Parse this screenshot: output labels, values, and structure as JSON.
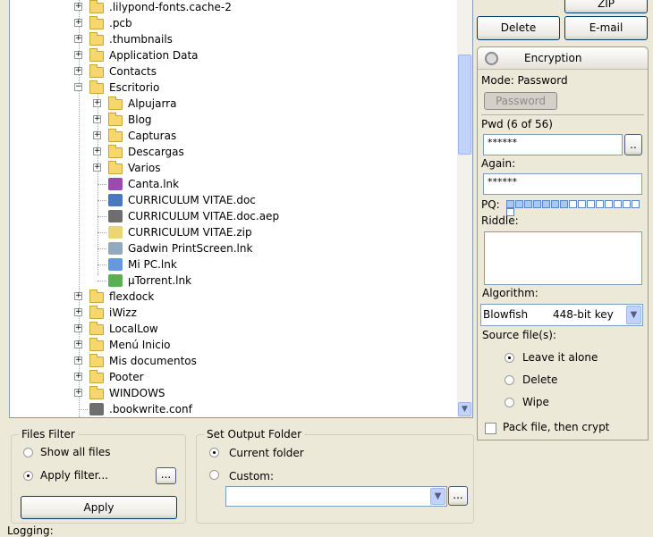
{
  "tree": {
    "items": [
      {
        "label": ".lilypond-fonts.cache-2",
        "level": 1,
        "type": "folder",
        "expander": "+"
      },
      {
        "label": ".pcb",
        "level": 1,
        "type": "folder",
        "expander": "+"
      },
      {
        "label": ".thumbnails",
        "level": 1,
        "type": "folder",
        "expander": "+"
      },
      {
        "label": "Application Data",
        "level": 1,
        "type": "folder",
        "expander": "+"
      },
      {
        "label": "Contacts",
        "level": 1,
        "type": "folder",
        "expander": "+"
      },
      {
        "label": "Escritorio",
        "level": 1,
        "type": "folder",
        "expander": "-"
      },
      {
        "label": "Alpujarra",
        "level": 2,
        "type": "folder",
        "expander": "+"
      },
      {
        "label": "Blog",
        "level": 2,
        "type": "folder",
        "expander": "+"
      },
      {
        "label": "Capturas",
        "level": 2,
        "type": "folder",
        "expander": "+"
      },
      {
        "label": "Descargas",
        "level": 2,
        "type": "folder",
        "expander": "+"
      },
      {
        "label": "Varios",
        "level": 2,
        "type": "folder",
        "expander": "+"
      },
      {
        "label": "Canta.lnk",
        "level": 2,
        "type": "shortcut-icon",
        "color": "#8a2b9e"
      },
      {
        "label": "CURRICULUM VITAE.doc",
        "level": 2,
        "type": "word-doc-icon",
        "color": "#2b5fb4"
      },
      {
        "label": "CURRICULUM VITAE.doc.aep",
        "level": 2,
        "type": "key-icon",
        "color": "#555555"
      },
      {
        "label": "CURRICULUM VITAE.zip",
        "level": 2,
        "type": "zip-icon",
        "color": "#e8cf5a"
      },
      {
        "label": "Gadwin PrintScreen.lnk",
        "level": 2,
        "type": "printscreen-icon",
        "color": "#7f9bb5"
      },
      {
        "label": "Mi PC.lnk",
        "level": 2,
        "type": "computer-icon",
        "color": "#4a86d6"
      },
      {
        "label": "µTorrent.lnk",
        "level": 2,
        "type": "utorrent-icon",
        "color": "#3aa335"
      },
      {
        "label": "flexdock",
        "level": 1,
        "type": "folder",
        "expander": "+"
      },
      {
        "label": "iWizz",
        "level": 1,
        "type": "folder",
        "expander": "+"
      },
      {
        "label": "LocalLow",
        "level": 1,
        "type": "folder",
        "expander": "+"
      },
      {
        "label": "Menú Inicio",
        "level": 1,
        "type": "folder",
        "expander": "+"
      },
      {
        "label": "Mis documentos",
        "level": 1,
        "type": "folder",
        "expander": "+"
      },
      {
        "label": "Pooter",
        "level": 1,
        "type": "folder",
        "expander": "+"
      },
      {
        "label": "WINDOWS",
        "level": 1,
        "type": "folder",
        "expander": "+"
      },
      {
        "label": ".bookwrite.conf",
        "level": 1,
        "type": "config-file-icon",
        "color": "#555555"
      }
    ]
  },
  "actions": {
    "zip": "ZIP",
    "delete": "Delete",
    "email": "E-mail"
  },
  "encryption": {
    "title": "Encryption",
    "mode": "Mode: Password",
    "mode_button": "Password",
    "pwd_label": "Pwd (6 of 56)",
    "pwd_value": "******",
    "browse": "..",
    "again_label": "Again:",
    "again_value": "******",
    "pq_label": "PQ:",
    "pq_total": 16,
    "pq_filled": 7,
    "riddle_label": "Riddle:",
    "riddle_value": "",
    "algorithm_label": "Algorithm:",
    "algorithm": "Blowfish",
    "key_size": "448-bit key",
    "source_label": "Source file(s):",
    "source_options": [
      {
        "label": "Leave it alone",
        "checked": true
      },
      {
        "label": "Delete",
        "checked": false
      },
      {
        "label": "Wipe",
        "checked": false
      }
    ],
    "pack_label": "Pack file, then crypt",
    "pack_checked": false
  },
  "filter": {
    "title": "Files Filter",
    "show_all": "Show all files",
    "apply_filter": "Apply filter...",
    "selected": "apply_filter",
    "browse": "...",
    "apply": "Apply"
  },
  "output": {
    "title": "Set Output Folder",
    "current": "Current folder",
    "custom": "Custom:",
    "selected": "current",
    "custom_value": "",
    "browse": "..."
  },
  "logging": "Logging:"
}
